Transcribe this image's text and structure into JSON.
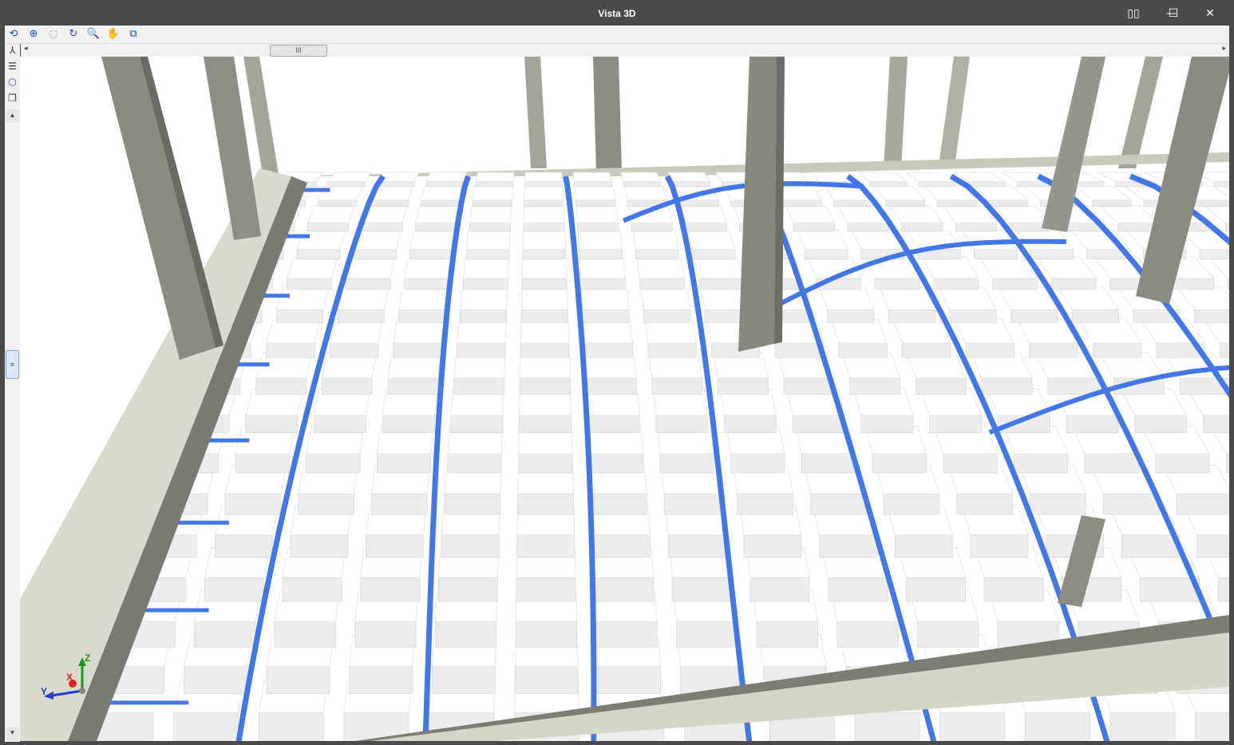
{
  "window": {
    "title": "Vista 3D"
  },
  "titlebar_buttons": [
    {
      "name": "snap-layout-icon",
      "glyph": "▯▯"
    },
    {
      "name": "minimize-button",
      "glyph": "—"
    },
    {
      "name": "maximize-button",
      "glyph": "☐"
    },
    {
      "name": "close-button",
      "glyph": "✕"
    }
  ],
  "toolbar": {
    "tools": [
      {
        "name": "rotate-view-icon",
        "glyph": "⟲"
      },
      {
        "name": "zoom-extents-icon",
        "glyph": "⊕"
      },
      {
        "name": "zoom-previous-icon",
        "glyph": "◌"
      },
      {
        "name": "redraw-icon",
        "glyph": "↻"
      },
      {
        "name": "zoom-window-icon",
        "glyph": "🔍"
      },
      {
        "name": "pan-hand-icon",
        "glyph": "✋"
      },
      {
        "name": "fit-window-icon",
        "glyph": "⧉"
      }
    ]
  },
  "scrollbar": {
    "thumb_grip": "III",
    "left_arrow": "◂",
    "right_arrow": "▸"
  },
  "side_tools": [
    {
      "name": "axis-icon",
      "glyph": "⅄"
    },
    {
      "name": "layers-icon",
      "glyph": "☰"
    },
    {
      "name": "cube-icon",
      "glyph": "⬡"
    },
    {
      "name": "box-view-icon",
      "glyph": "❐"
    },
    {
      "name": "scroll-up-arrow",
      "glyph": "▴"
    },
    {
      "name": "scroll-down-arrow",
      "glyph": "▾"
    }
  ],
  "vthumb_grip": "≡",
  "axes": {
    "z": "Z",
    "x": "X",
    "y": "Y"
  },
  "colors": {
    "rib_blue": "#4477e6",
    "column_gray": "#8a8a80",
    "beam_beige": "#d8d8cc",
    "block_white": "#ffffff"
  }
}
